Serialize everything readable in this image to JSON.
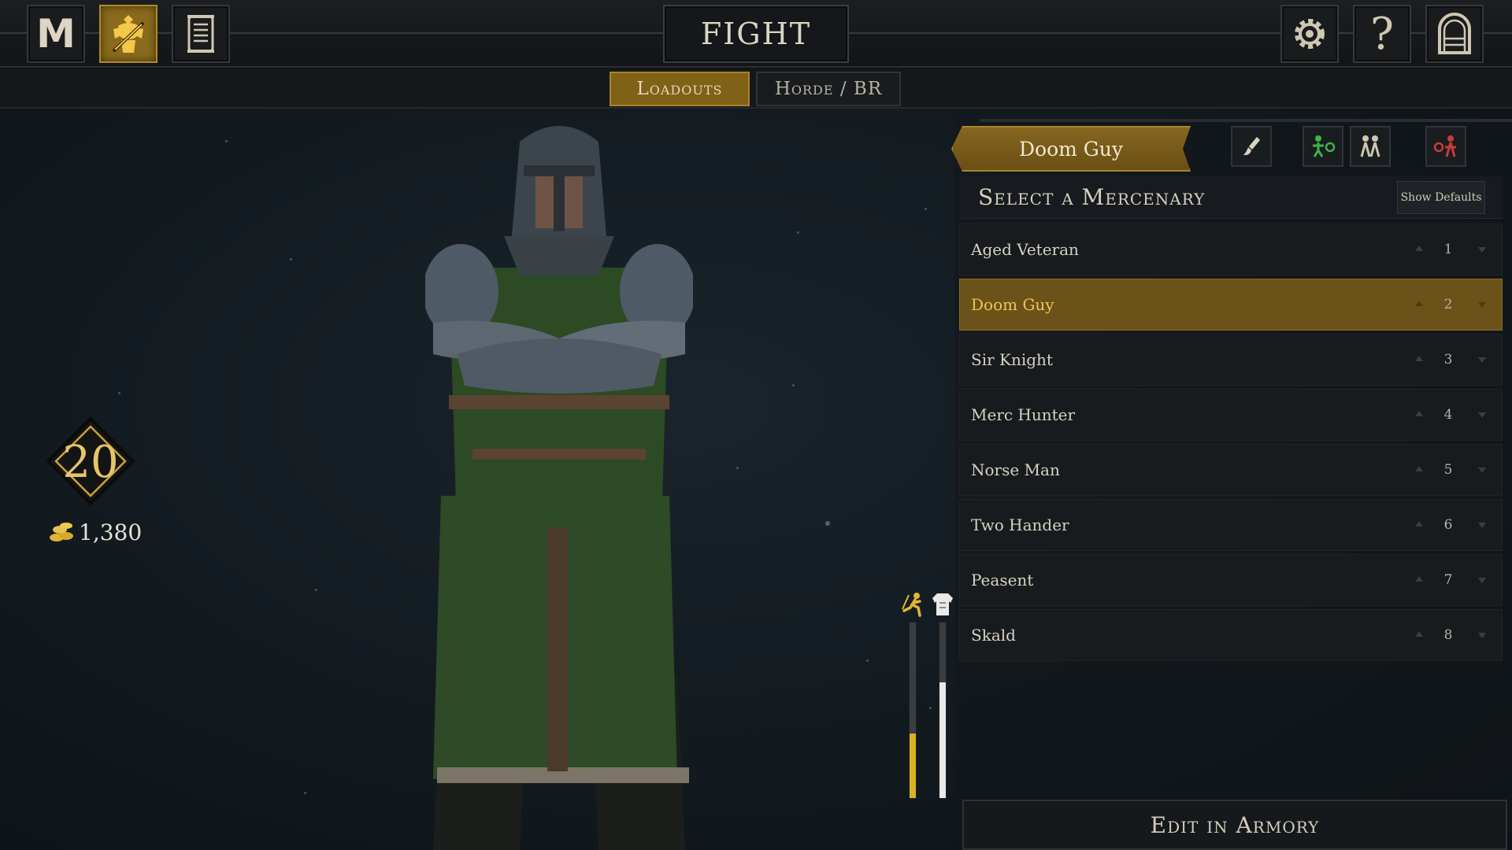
{
  "topbar": {
    "title": "FIGHT",
    "nav": [
      {
        "icon": "mordhau-logo-icon",
        "label": "M",
        "active": false
      },
      {
        "icon": "character-loadout-icon",
        "active": true
      },
      {
        "icon": "scroll-icon",
        "active": false
      }
    ],
    "right": [
      {
        "icon": "gear-icon"
      },
      {
        "icon": "help-icon",
        "label": "?"
      },
      {
        "icon": "exit-door-icon"
      }
    ]
  },
  "tabs": [
    {
      "label": "Loadouts",
      "active": true
    },
    {
      "label": "Horde / BR",
      "active": false
    }
  ],
  "player": {
    "level": "20",
    "gold": "1,380",
    "gold_icon": "gold-coins-icon"
  },
  "stats": {
    "speed_icon": "running-man-icon",
    "armor_icon": "armor-icon",
    "speed_level": 0.37,
    "armor_level": 0.66,
    "speed_color": "#d9b320",
    "armor_color": "#e9e9e9"
  },
  "panel": {
    "current_loadout": "Doom Guy",
    "header_icons": [
      "paint-brush-icon",
      "add-mercenary-icon",
      "group-mercenary-icon",
      "remove-mercenary-icon"
    ],
    "select_title": "Select a Mercenary",
    "show_defaults": "Show Defaults",
    "mercenaries": [
      {
        "name": "Aged Veteran",
        "order": "1",
        "selected": false
      },
      {
        "name": "Doom Guy",
        "order": "2",
        "selected": true
      },
      {
        "name": "Sir Knight",
        "order": "3",
        "selected": false
      },
      {
        "name": "Merc Hunter",
        "order": "4",
        "selected": false
      },
      {
        "name": "Norse Man",
        "order": "5",
        "selected": false
      },
      {
        "name": "Two Hander",
        "order": "6",
        "selected": false
      },
      {
        "name": "Peasent",
        "order": "7",
        "selected": false
      },
      {
        "name": "Skald",
        "order": "8",
        "selected": false
      }
    ],
    "edit_button": "Edit in Armory"
  },
  "colors": {
    "accent_gold": "#8a6a1c",
    "text_gold": "#e6c56a"
  }
}
